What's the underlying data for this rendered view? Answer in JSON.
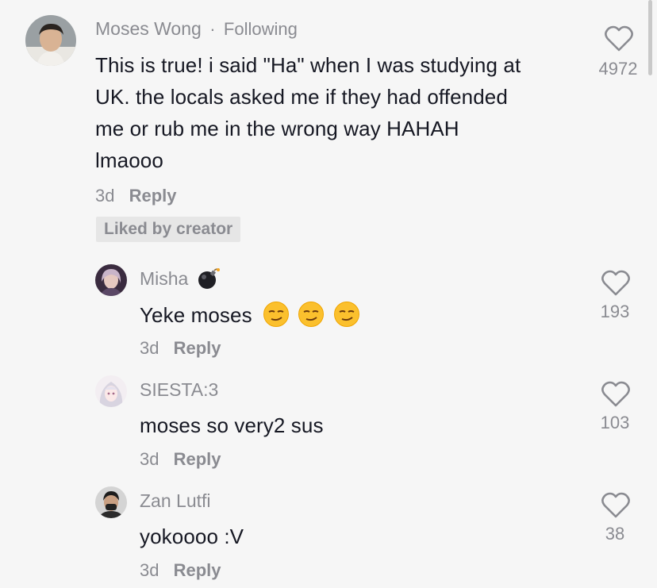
{
  "colors": {
    "background": "#f6f6f6",
    "secondary_text": "#8a8b91",
    "primary_text": "#161823",
    "badge_bg": "#e6e6e6"
  },
  "main_comment": {
    "username": "Moses Wong",
    "separator": "·",
    "following": "Following",
    "lines": [
      "This is true! i said \"Ha\" when I was studying at",
      "UK. the locals asked me if they had offended",
      "me or rub me in the wrong way HAHAH",
      "lmaooo"
    ],
    "time": "3d",
    "reply_label": "Reply",
    "liked_by_creator": "Liked by creator",
    "like_icon": "heart-outline-icon",
    "likes": "4972"
  },
  "replies": [
    {
      "username": "Misha",
      "badge_icon": "bomb-icon",
      "text": "Yeke moses",
      "emoji_icon": "smirking-face-icon",
      "emoji_count": 3,
      "time": "3d",
      "reply_label": "Reply",
      "like_icon": "heart-outline-icon",
      "likes": "193"
    },
    {
      "username": "SIESTA:3",
      "text": "moses so very2 sus",
      "time": "3d",
      "reply_label": "Reply",
      "like_icon": "heart-outline-icon",
      "likes": "103"
    },
    {
      "username": "Zan Lutfi",
      "text": "yokoooo :V",
      "time": "3d",
      "reply_label": "Reply",
      "like_icon": "heart-outline-icon",
      "likes": "38"
    }
  ]
}
